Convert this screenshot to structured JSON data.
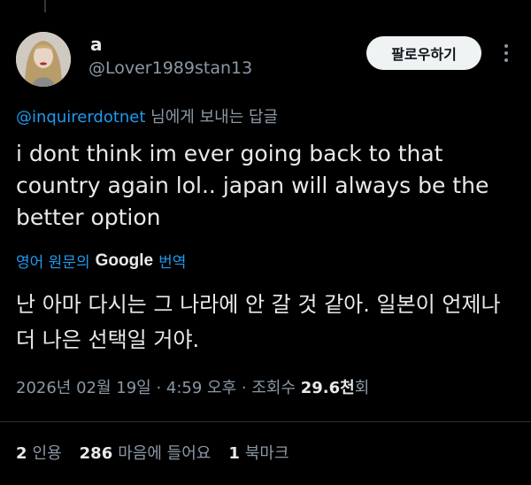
{
  "author": {
    "display_name": "a",
    "handle": "@Lover1989stan13"
  },
  "follow_label": "팔로우하기",
  "reply": {
    "mention": "@inquirerdotnet",
    "suffix": " 님에게 보내는 답글"
  },
  "tweet_text": "i dont think im ever going back to that country again lol.. japan will always be the better option",
  "translation": {
    "prefix": "영어 원문의",
    "provider": "Google",
    "suffix": "번역",
    "text": "난 아마 다시는 그 나라에 안 갈 것 같아. 일본이 언제나 더 나은 선택일 거야."
  },
  "meta": {
    "date_time": "2026년 02월 19일 · 4:59 오후 · 조회수 ",
    "views": "29.6천",
    "views_suffix": "회"
  },
  "stats": {
    "quotes_count": "2",
    "quotes_label": "인용",
    "likes_count": "286",
    "likes_label": "마음에 들어요",
    "bookmarks_count": "1",
    "bookmarks_label": "북마크"
  },
  "colors": {
    "background": "#000000",
    "text": "#e7e9ea",
    "secondary": "#8b98a5",
    "accent": "#1d9bf0"
  }
}
